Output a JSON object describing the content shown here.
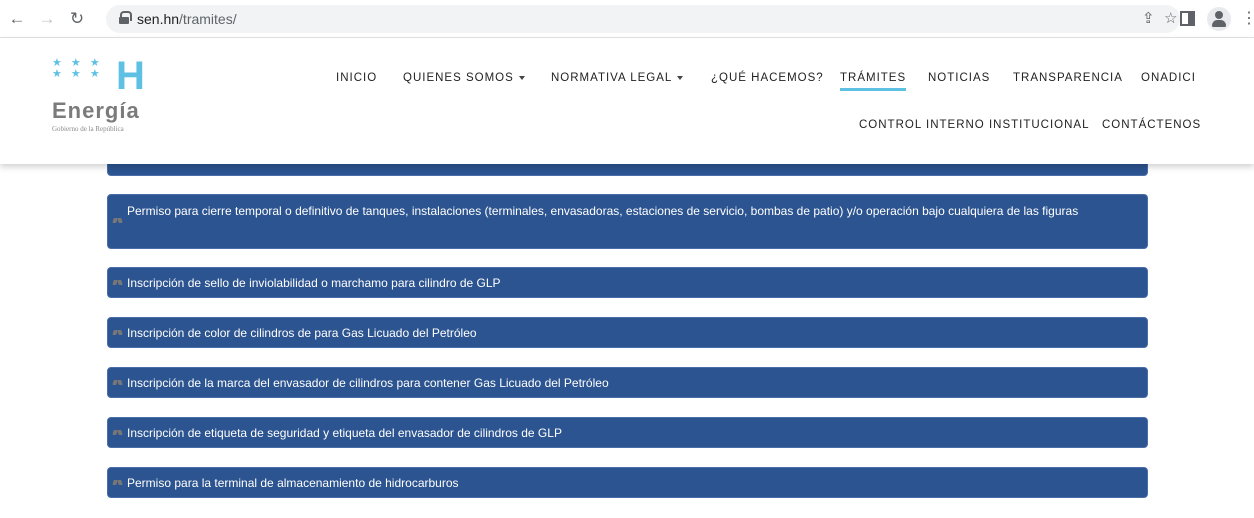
{
  "browser": {
    "url_host": "sen.hn",
    "url_path": "/tramites/"
  },
  "logo": {
    "title": "Energía",
    "subtitle": "Gobierno de la República",
    "mark": "H"
  },
  "menu": {
    "inicio": "INICIO",
    "quienes_somos": "QUIENES SOMOS",
    "normativa_legal": "NORMATIVA LEGAL",
    "que_hacemos": "¿QUÉ HACEMOS?",
    "tramites": "TRÁMITES",
    "noticias": "NOTICIAS",
    "transparencia": "TRANSPARENCIA",
    "onadici": "ONADICI",
    "control_interno": "CONTROL INTERNO INSTITUCIONAL",
    "contactenos": "CONTÁCTENOS"
  },
  "colors": {
    "accent": "#5ec1e3",
    "panel": "#2c5490"
  },
  "tramites": [
    {
      "label": "Permiso para cierre temporal o definitivo de tanques, instalaciones (terminales, envasadoras, estaciones de servicio, bombas de patio) y/o operación bajo cualquiera de las figuras"
    },
    {
      "label": "Inscripción de sello de inviolabilidad o marchamo para cilindro de GLP"
    },
    {
      "label": "Inscripción de color de cilindros de para Gas Licuado del Petróleo"
    },
    {
      "label": "Inscripción de la marca del envasador de cilindros para contener Gas Licuado del Petróleo"
    },
    {
      "label": "Inscripción de etiqueta de seguridad y etiqueta del envasador de cilindros de GLP"
    },
    {
      "label": "Permiso para la terminal de almacenamiento de hidrocarburos"
    }
  ]
}
